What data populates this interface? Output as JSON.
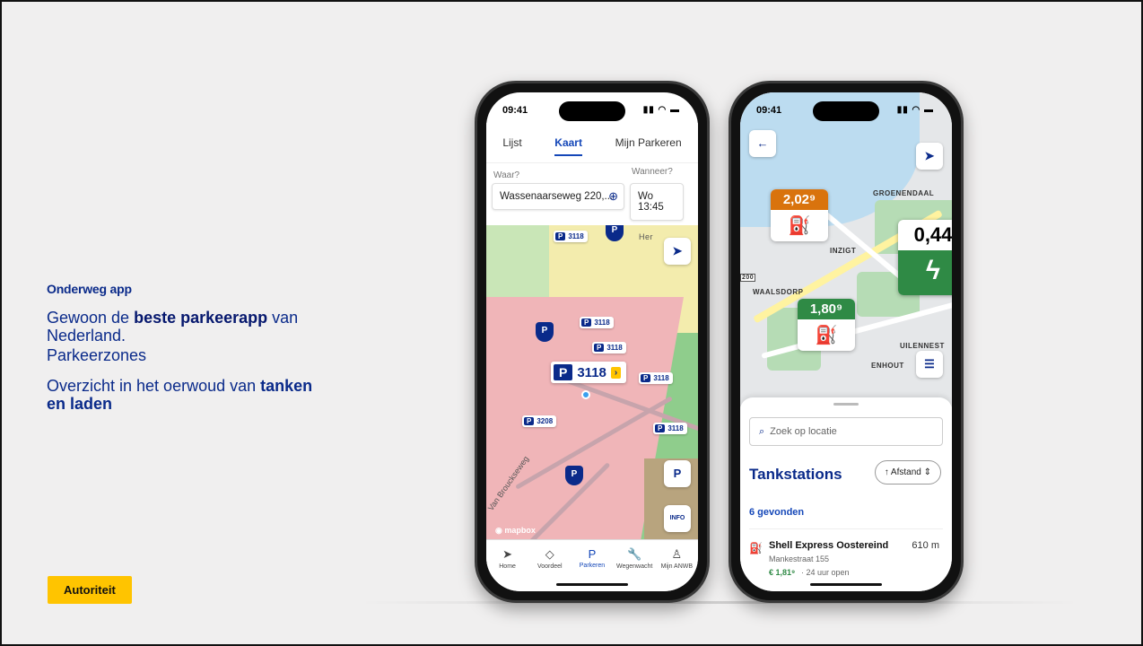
{
  "slide": {
    "kicker": "Onderweg app",
    "lead_prefix": "Gewoon de ",
    "lead_bold": "beste parkeerapp",
    "lead_suffix": " van Nederland.",
    "lead_line2": "Parkeerzones",
    "lead2_prefix": "Overzicht in het oerwoud van ",
    "lead2_bold": "tanken en laden",
    "badge": "Autoriteit"
  },
  "phone1": {
    "time": "09:41",
    "tabs": [
      "Lijst",
      "Kaart",
      "Mijn Parkeren"
    ],
    "active_tab": "Kaart",
    "where_label": "Waar?",
    "where_value": "Wassenaarseweg 220,...",
    "when_label": "Wanneer?",
    "when_value": "Wo 13:45",
    "zone_code": "3118",
    "zone_code_other": "3208",
    "map_street": "Van Brouckseweg",
    "map_place": "Her",
    "mapbox_label": "mapbox",
    "parking_button": "P",
    "info_button": "INFO",
    "nav": [
      {
        "icon": "➤",
        "label": "Home"
      },
      {
        "icon": "◇",
        "label": "Voordeel"
      },
      {
        "icon": "P",
        "label": "Parkeren"
      },
      {
        "icon": "🔧",
        "label": "Wegenwacht"
      },
      {
        "icon": "♙",
        "label": "Mijn ANWB"
      }
    ]
  },
  "phone2": {
    "time": "09:41",
    "places": [
      "GROENENDAAL",
      "INZIGT",
      "WAALSDORP",
      "UILENNEST",
      "ENHOUT"
    ],
    "road_number": "200",
    "price_orange": "2,02⁹",
    "price_green": "1,80⁹",
    "ev_price": "0,44",
    "colors": {
      "orange": "#d9730d",
      "green": "#2f8a45",
      "brand": "#0a2a8a",
      "yellow": "#ffc400"
    },
    "search_placeholder": "Zoek op locatie",
    "list_title": "Tankstations",
    "sort_label": "↑ Afstand ⇕",
    "count_label": "6 gevonden",
    "station": {
      "name": "Shell Express Oostereind",
      "distance": "610 m",
      "address": "Mankestraat 155",
      "price": "€ 1,81⁹",
      "open": "· 24 uur open"
    }
  }
}
